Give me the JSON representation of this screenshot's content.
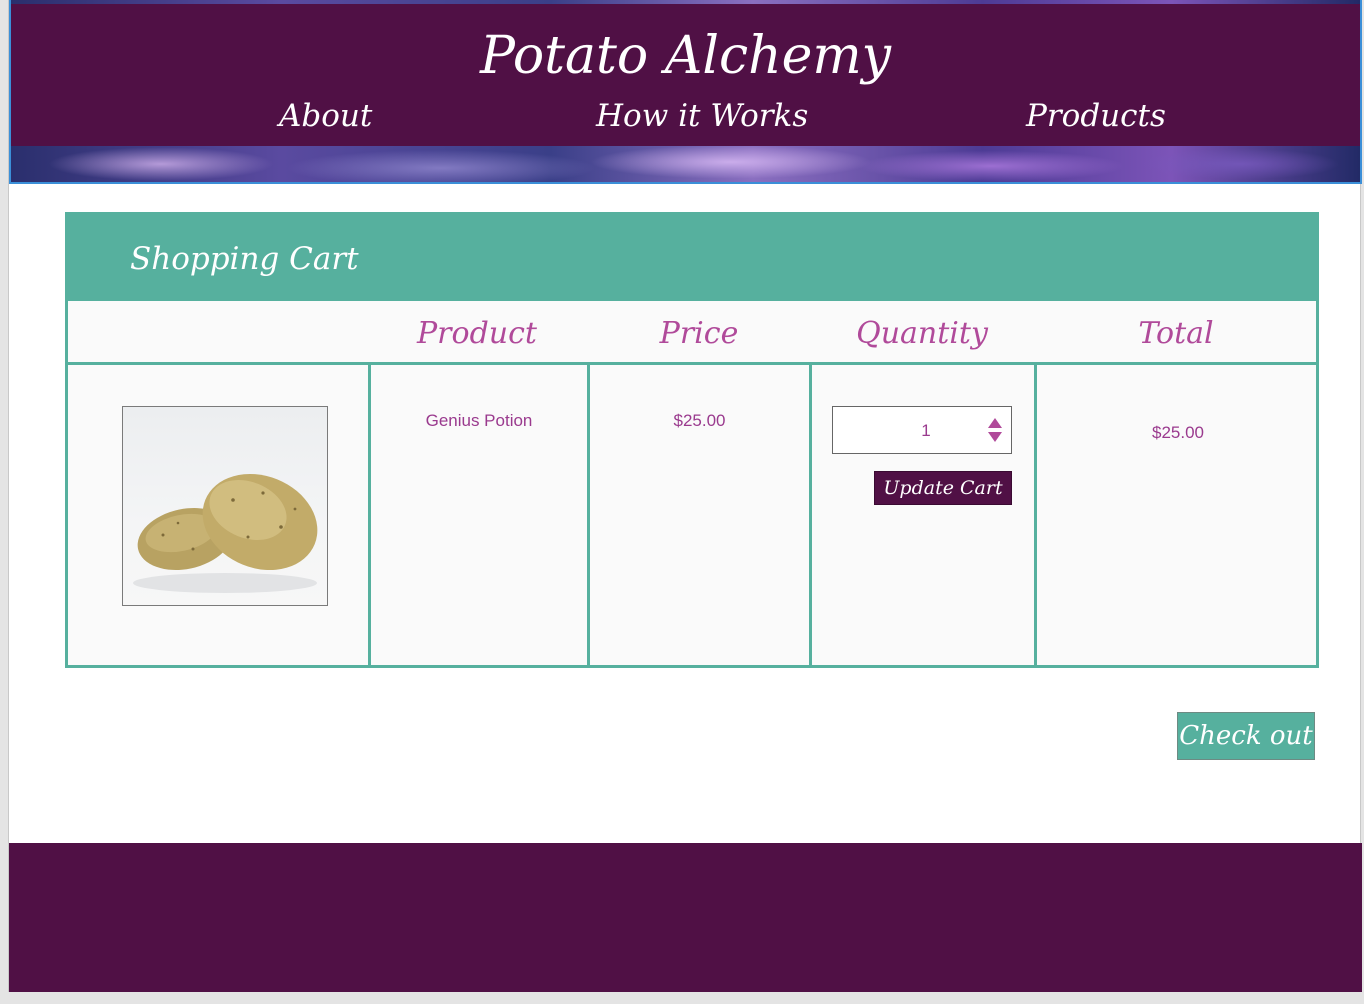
{
  "site": {
    "title": "Potato Alchemy",
    "nav": [
      {
        "label": "About"
      },
      {
        "label": "How it Works"
      },
      {
        "label": "Products"
      }
    ]
  },
  "cart": {
    "title": "Shopping Cart",
    "columns": [
      "",
      "Product",
      "Price",
      "Quantity",
      "Total"
    ],
    "items": [
      {
        "image_alt": "potatoes",
        "product": "Genius Potion",
        "price": "$25.00",
        "quantity": "1",
        "total": "$25.00"
      }
    ],
    "update_label": "Update Cart",
    "checkout_label": "Check out"
  },
  "colors": {
    "header_purple": "#501045",
    "teal": "#56b09e",
    "text_magenta": "#b04a9a",
    "footer_purple": "#501045"
  }
}
